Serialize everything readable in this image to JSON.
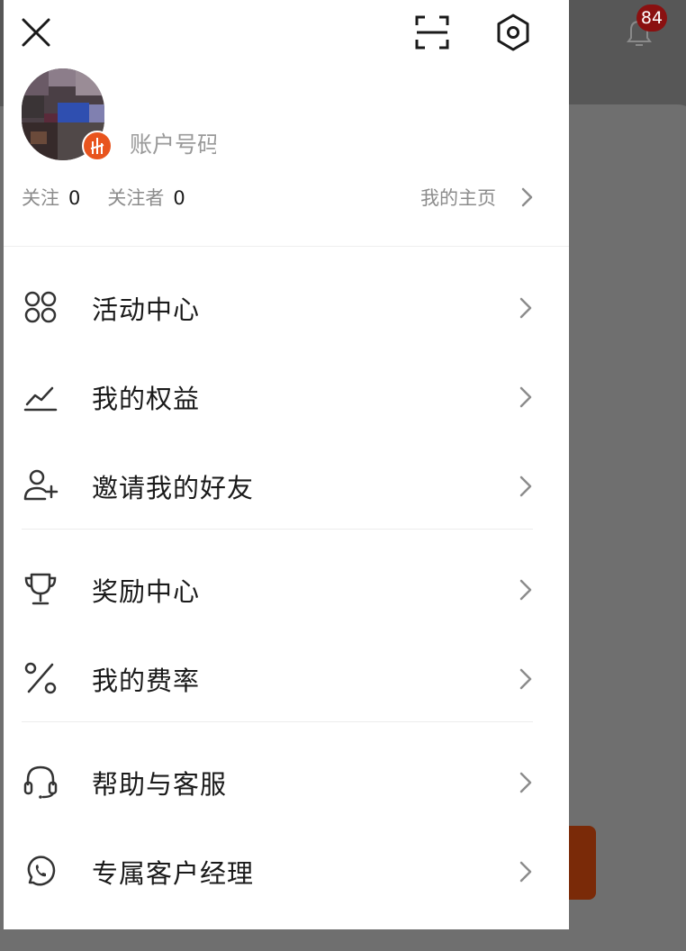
{
  "background": {
    "notification_badge": "84"
  },
  "drawer": {
    "account_label": "账户号码",
    "follow": {
      "following_label": "关注",
      "following_count": "0",
      "followers_label": "关注者",
      "followers_count": "0"
    },
    "homepage_label": "我的主页",
    "menu": [
      {
        "label": "活动中心",
        "icon": "apps-icon"
      },
      {
        "label": "我的权益",
        "icon": "trend-chart-icon"
      },
      {
        "label": "邀请我的好友",
        "icon": "user-add-icon"
      },
      {
        "label": "奖励中心",
        "icon": "trophy-icon"
      },
      {
        "label": "我的费率",
        "icon": "percent-icon"
      },
      {
        "label": "帮助与客服",
        "icon": "headset-icon"
      },
      {
        "label": "专属客户经理",
        "icon": "whatsapp-icon"
      }
    ]
  },
  "colors": {
    "text_primary": "#1a1a1a",
    "text_secondary": "#8c8c8c",
    "accent": "#e8541e",
    "overlay": "#6f6f6f"
  }
}
